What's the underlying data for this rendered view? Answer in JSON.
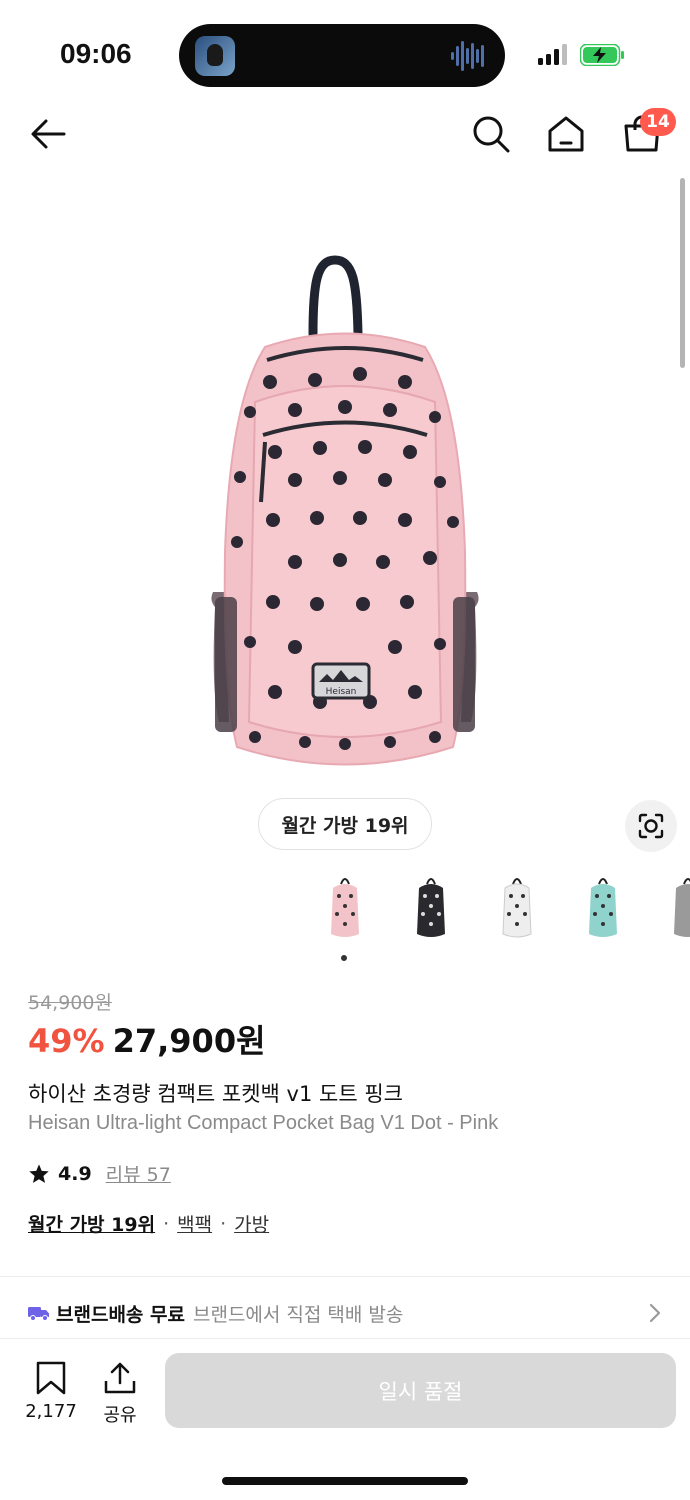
{
  "status_bar": {
    "time": "09:06"
  },
  "header": {
    "cart_badge": "14"
  },
  "product": {
    "rank_badge": "월간 가방 19위",
    "original_price": "54,900원",
    "discount": "49%",
    "price": "27,900원",
    "title_ko": "하이산 초경량 컴팩트 포켓백 v1 도트 핑크",
    "title_en": "Heisan Ultra-light Compact Pocket Bag V1 Dot - Pink",
    "rating": "4.9",
    "review_label": "리뷰 57",
    "tags": {
      "main": "월간 가방 19위",
      "sep": "·",
      "tag1": "백팩",
      "tag2": "가방"
    },
    "label_text": "Heisan"
  },
  "color_options": [
    {
      "name": "pink",
      "color": "#f2c4c9",
      "dots": "#333333"
    },
    {
      "name": "black",
      "color": "#2a2a2e",
      "dots": "#dddddd"
    },
    {
      "name": "white",
      "color": "#eeeeee",
      "dots": "#333333"
    },
    {
      "name": "mint",
      "color": "#8fd3cc",
      "dots": "#333333"
    },
    {
      "name": "gray",
      "color": "#9a9a9a",
      "dots": "#555555"
    }
  ],
  "delivery": {
    "strong": "브랜드배송 무료",
    "sub": "브랜드에서 직접 택배 발송"
  },
  "bottom_bar": {
    "bookmark_count": "2,177",
    "share_label": "공유",
    "buy_label": "일시 품절"
  },
  "colors": {
    "accent_red": "#f0533f",
    "badge_red": "#ff5a4d",
    "truck_purple": "#6e62e6",
    "disabled_button": "#d9d9d9"
  }
}
